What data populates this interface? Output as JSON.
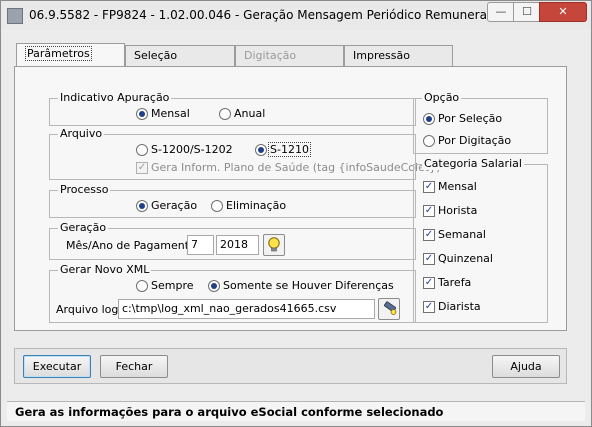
{
  "window": {
    "title": "06.9.5582 - FP9824 - 1.02.00.046 - Geração Mensagem Periódico Remuneração",
    "minimize_glyph": "—",
    "maximize_glyph": "☐",
    "close_glyph": "✕"
  },
  "tabs": [
    {
      "label": "Parâmetros"
    },
    {
      "label": "Seleção"
    },
    {
      "label": "Digitação"
    },
    {
      "label": "Impressão"
    }
  ],
  "indicativo": {
    "legend": "Indicativo Apuração",
    "options": [
      "Mensal",
      "Anual"
    ]
  },
  "arquivo": {
    "legend": "Arquivo",
    "options": [
      "S-1200/S-1202",
      "S-1210"
    ],
    "checkbox_label": "Gera Inform. Plano de Saúde (tag {infoSaudeColet})"
  },
  "processo": {
    "legend": "Processo",
    "options": [
      "Geração",
      "Eliminação"
    ]
  },
  "geracao": {
    "legend": "Geração",
    "label": "Mês/Ano de Pagamento:",
    "month": "7",
    "year": "2018"
  },
  "gerar_xml": {
    "legend": "Gerar Novo XML",
    "options": [
      "Sempre",
      "Somente se Houver Diferenças"
    ],
    "log_label": "Arquivo log:",
    "log_path": "c:\\tmp\\log_xml_nao_gerados41665.csv"
  },
  "opcao": {
    "legend": "Opção",
    "options": [
      "Por Seleção",
      "Por Digitação"
    ]
  },
  "categoria": {
    "legend": "Categoria Salarial",
    "items": [
      "Mensal",
      "Horista",
      "Semanal",
      "Quinzenal",
      "Tarefa",
      "Diarista"
    ],
    "check_glyph": "✓"
  },
  "buttons": {
    "executar": "Executar",
    "fechar": "Fechar",
    "ajuda": "Ajuda"
  },
  "status_text": "Gera as informações para o arquivo eSocial conforme selecionado",
  "icons": {
    "calendar": "lightbulb-icon",
    "file_browse": "flashlight-icon"
  }
}
